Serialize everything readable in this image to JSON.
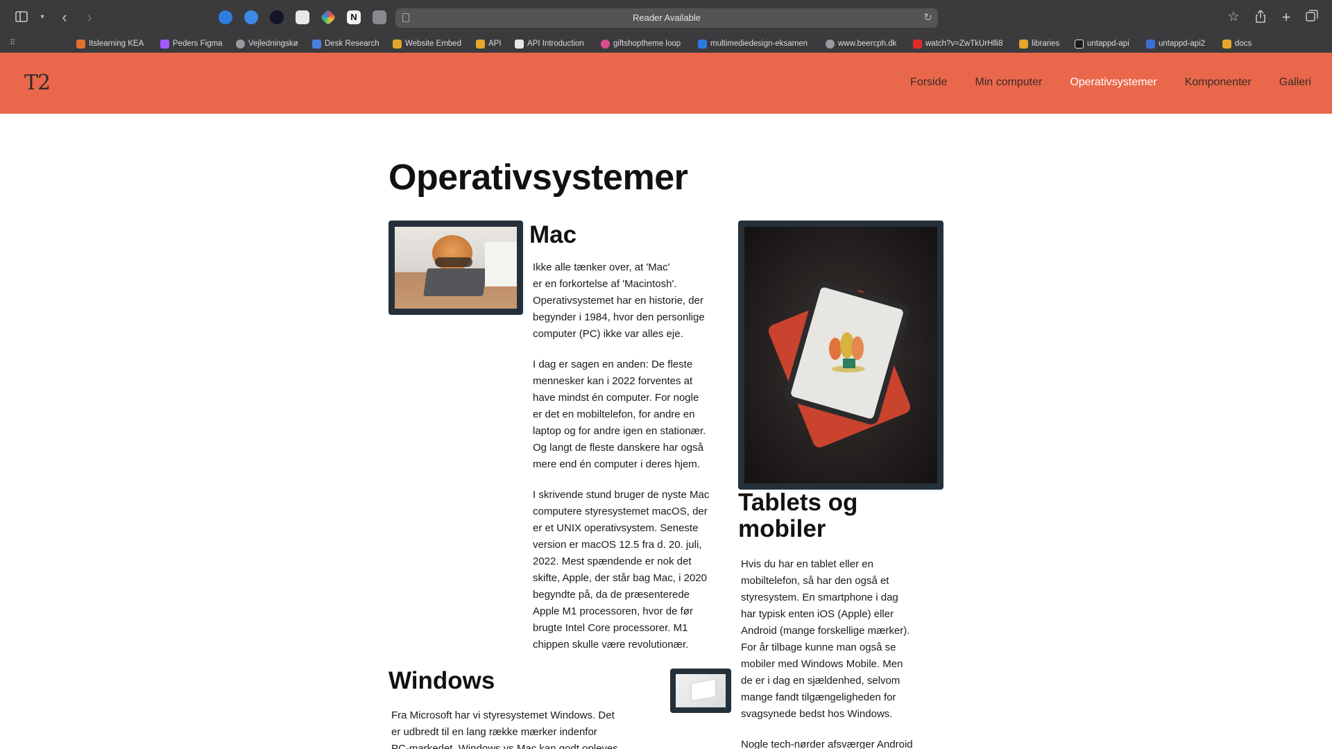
{
  "browser": {
    "address_text": "Reader Available",
    "bookmarks": [
      {
        "label": "Itslearning KEA",
        "icon": "itslearning-icon",
        "color": "#e56f2c"
      },
      {
        "label": "Peders Figma",
        "icon": "figma-icon",
        "color": "#a259ff"
      },
      {
        "label": "Vejledningskø",
        "icon": "globe-icon",
        "color": "#9a9a9e"
      },
      {
        "label": "Desk Research",
        "icon": "docs-icon",
        "color": "#4a7fe0"
      },
      {
        "label": "Website Embed",
        "icon": "folder-icon",
        "color": "#e4a72b"
      },
      {
        "label": "API",
        "icon": "folder-icon",
        "color": "#e4a72b"
      },
      {
        "label": "API Introduction",
        "icon": "page-icon",
        "color": "#e8e8e8"
      },
      {
        "label": "giftshoptheme loop",
        "icon": "loop-icon",
        "color": "#d94c8f"
      },
      {
        "label": "multimediedesign-eksamen",
        "icon": "trello-icon",
        "color": "#2b7be0"
      },
      {
        "label": "www.beercph.dk",
        "icon": "globe-icon",
        "color": "#9a9a9e"
      },
      {
        "label": "watch?v=ZwTkUrHlli8",
        "icon": "youtube-icon",
        "color": "#e12b2b"
      },
      {
        "label": "libraries",
        "icon": "folder-icon",
        "color": "#e4a72b"
      },
      {
        "label": "untappd-api",
        "icon": "code-icon",
        "color": "#1b1b1b"
      },
      {
        "label": "untappd-api2",
        "icon": "code-icon",
        "color": "#3b6fd8"
      },
      {
        "label": "docs",
        "icon": "folder-icon",
        "color": "#e4a72b"
      }
    ]
  },
  "site": {
    "logo": "T2",
    "nav": [
      {
        "label": "Forside",
        "active": false
      },
      {
        "label": "Min computer",
        "active": false
      },
      {
        "label": "Operativsystemer",
        "active": true
      },
      {
        "label": "Komponenter",
        "active": false
      },
      {
        "label": "Galleri",
        "active": false
      }
    ],
    "accent_color": "#e9684b"
  },
  "page": {
    "title": "Operativsystemer",
    "mac": {
      "heading": "Mac",
      "paragraphs": [
        "Ikke alle tænker over, at 'Mac'\ner en forkortelse af 'Macintosh'.\nOperativsystemet har en historie, der\nbegynder i 1984, hvor den personlige\ncomputer (PC) ikke var alles eje.",
        "I dag er sagen en anden: De fleste\nmennesker kan i 2022 forventes at\nhave mindst én computer. For nogle\ner det en mobiltelefon, for andre en\nlaptop og for andre igen en stationær.\nOg langt de fleste danskere har også\nmere end én computer i deres hjem.",
        "I skrivende stund bruger de nyste Mac\ncomputere styresystemet macOS, der\ner et UNIX operativsystem. Seneste\nversion er macOS 12.5 fra d. 20. juli,\n2022. Mest spændende er nok det\nskifte, Apple, der står bag Mac, i 2020\nbegyndte på, da de præsenterede\nApple M1 processoren, hvor de før\nbrugte Intel Core processorer. M1\nchippen skulle være revolutionær."
      ]
    },
    "windows": {
      "heading": "Windows",
      "paragraphs": [
        "Fra Microsoft har vi styresystemet Windows. Det\ner udbredt til en lang række mærker indenfor\nPC-markedet. Windows vs Mac kan godt opleves"
      ]
    },
    "tablets": {
      "heading": "Tablets og\nmobiler",
      "paragraphs": [
        "Hvis du har en tablet eller en\nmobiltelefon, så har den også et\nstyresystem. En smartphone i dag\nhar typisk enten iOS (Apple) eller\nAndroid (mange forskellige mærker).\nFor år tilbage kunne man også se\nmobiler med Windows Mobile. Men\nde er i dag en sjældenhed, selvom\nmange fandt tilgængeligheden for\nsvagsynede bedst hos Windows.",
        "Nogle tech-nørder afsværger Android"
      ]
    }
  }
}
